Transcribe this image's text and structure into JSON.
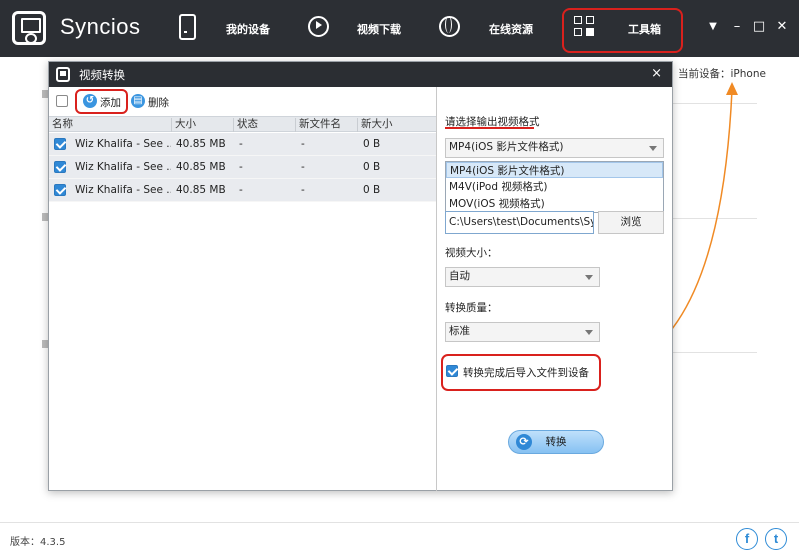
{
  "app": {
    "name": "Syncios"
  },
  "nav": [
    {
      "label": "我的设备",
      "icon": "phone-icon"
    },
    {
      "label": "视频下载",
      "icon": "play-icon"
    },
    {
      "label": "在线资源",
      "icon": "globe-icon"
    },
    {
      "label": "工具箱",
      "icon": "grid-icon"
    }
  ],
  "window_controls": {
    "menu": "▼",
    "minimize": "–",
    "maximize": "□",
    "close": "✕"
  },
  "current_device": "当前设备：iPhone",
  "dialog": {
    "title": "视频转换",
    "close": "×",
    "toolbar": {
      "add_label": "添加",
      "delete_label": "删除"
    },
    "columns": [
      "名称",
      "大小",
      "状态",
      "新文件名",
      "新大小"
    ],
    "rows": [
      {
        "checked": true,
        "name": "Wiz Khalifa - See ...",
        "size": "40.85 MB",
        "status": "-",
        "new_name": "-",
        "new_size": "0 B"
      },
      {
        "checked": true,
        "name": "Wiz Khalifa - See ...",
        "size": "40.85 MB",
        "status": "-",
        "new_name": "-",
        "new_size": "0 B"
      },
      {
        "checked": true,
        "name": "Wiz Khalifa - See ...",
        "size": "40.85 MB",
        "status": "-",
        "new_name": "-",
        "new_size": "0 B"
      }
    ],
    "format": {
      "title": "请选择输出视频格式",
      "selected": "MP4(iOS 影片文件格式)",
      "options": [
        "MP4(iOS 影片文件格式)",
        "M4V(iPod 视频格式)",
        "MOV(iOS 视频格式)"
      ]
    },
    "output_path": "C:\\Users\\test\\Documents\\Syncios",
    "browse_label": "浏览",
    "video_size": {
      "label": "视频大小：",
      "value": "自动"
    },
    "quality": {
      "label": "转换质量：",
      "value": "标准"
    },
    "import_option": {
      "label": "转换完成后导入文件到设备",
      "checked": true
    },
    "convert_label": "转换"
  },
  "footer": {
    "version": "版本：4.3.5",
    "social": [
      "f",
      "t"
    ]
  },
  "colors": {
    "topbar": "#2c2f34",
    "highlight": "#d9211d",
    "accent": "#2f88d6",
    "arrow": "#f08a24"
  }
}
